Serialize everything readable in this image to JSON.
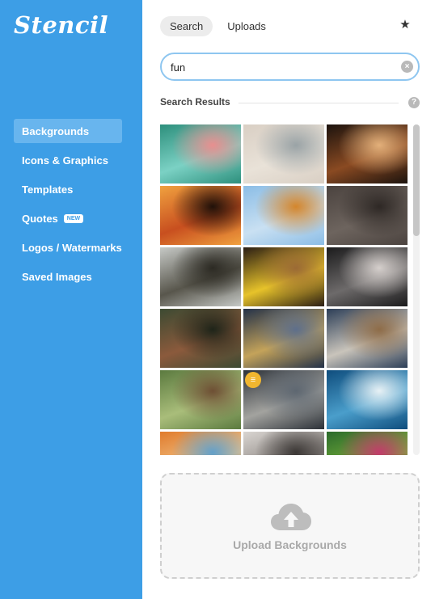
{
  "app": {
    "logo": "Stencil"
  },
  "sidebar": {
    "items": [
      {
        "label": "Backgrounds",
        "active": true
      },
      {
        "label": "Icons & Graphics"
      },
      {
        "label": "Templates"
      },
      {
        "label": "Quotes",
        "badge": "NEW"
      },
      {
        "label": "Logos / Watermarks"
      },
      {
        "label": "Saved Images"
      }
    ]
  },
  "tabs": [
    {
      "label": "Search",
      "active": true
    },
    {
      "label": "Uploads"
    }
  ],
  "favorites_icon": "star-icon",
  "search": {
    "value": "fun",
    "clear_icon": "clear-icon"
  },
  "results": {
    "title": "Search Results",
    "help_icon": "help-icon"
  },
  "thumbnails": [
    {
      "name": "pool-float-jump",
      "colors": [
        "#2d8f7c",
        "#7bd1c4",
        "#e88f8f"
      ]
    },
    {
      "name": "child-on-bench",
      "colors": [
        "#d9cfc4",
        "#e9e2d8",
        "#9aa3a6"
      ]
    },
    {
      "name": "concert-crowd",
      "colors": [
        "#1c130e",
        "#8a4a22",
        "#e3b07a"
      ]
    },
    {
      "name": "sunset-jump",
      "colors": [
        "#f0a13f",
        "#c84f1f",
        "#201109"
      ]
    },
    {
      "name": "party-decoration",
      "colors": [
        "#8bbde6",
        "#c9e0f2",
        "#d4862c"
      ]
    },
    {
      "name": "hands-on-wall",
      "colors": [
        "#4b433f",
        "#6d645e",
        "#2e2825"
      ]
    },
    {
      "name": "friends-in-park",
      "colors": [
        "#c6c9c6",
        "#58564c",
        "#2c2a23"
      ]
    },
    {
      "name": "smiley-balls",
      "colors": [
        "#2a1d14",
        "#e7c32a",
        "#9b6a35"
      ]
    },
    {
      "name": "hair-flip",
      "colors": [
        "#1b1b1c",
        "#6d6a6a",
        "#d5cfcc"
      ]
    },
    {
      "name": "girl-in-forest",
      "colors": [
        "#3c4a32",
        "#8b5a3c",
        "#1e2419"
      ]
    },
    {
      "name": "cliff-sunset-jump",
      "colors": [
        "#233149",
        "#c4a35a",
        "#5e6f8b"
      ]
    },
    {
      "name": "car-window-hair",
      "colors": [
        "#2c3e57",
        "#c9c4bb",
        "#8e6c48"
      ]
    },
    {
      "name": "bridge-jump",
      "colors": [
        "#5b7a3f",
        "#a9bd7a",
        "#6e4f34"
      ]
    },
    {
      "name": "group-jump",
      "colors": [
        "#2c3138",
        "#a3a39f",
        "#5e6771"
      ],
      "badge": true
    },
    {
      "name": "big-wave-surf",
      "colors": [
        "#0f4d7d",
        "#4a9ecb",
        "#e7f1f5"
      ]
    },
    {
      "name": "orange-toy",
      "colors": [
        "#e07b2c",
        "#f2c58a",
        "#63a0c9"
      ]
    },
    {
      "name": "crowd-confetti",
      "colors": [
        "#d9d5d1",
        "#8b8581",
        "#3c3836"
      ]
    },
    {
      "name": "green-puppet",
      "colors": [
        "#2b6a2b",
        "#79b23b",
        "#c23b6b"
      ]
    }
  ],
  "upload": {
    "label": "Upload Backgrounds",
    "icon": "cloud-upload-icon"
  }
}
